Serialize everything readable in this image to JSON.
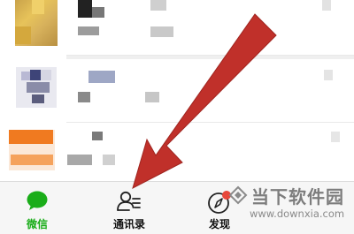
{
  "tabbar": {
    "tabs": [
      {
        "label": "微信",
        "icon": "chat-bubble-icon",
        "active": true
      },
      {
        "label": "通讯录",
        "icon": "contacts-icon",
        "active": false
      },
      {
        "label": "发现",
        "icon": "compass-icon",
        "active": false
      }
    ]
  },
  "watermark": {
    "title": "当下软件园",
    "url": "www.downxia.com"
  },
  "colors": {
    "accent_green": "#1aad19",
    "arrow_red": "#c0302a",
    "badge_red": "#e8483b",
    "tabbar_bg": "#f6f6f6"
  }
}
